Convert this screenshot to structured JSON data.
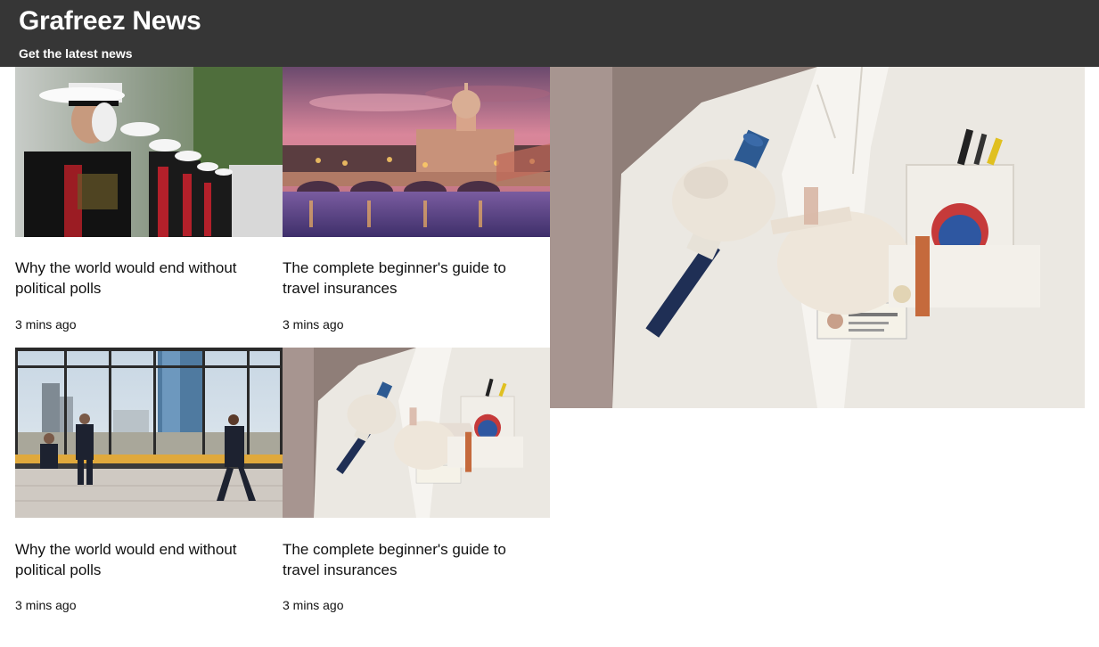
{
  "header": {
    "title": "Grafreez News",
    "tagline": "Get the latest news"
  },
  "articles": [
    {
      "title": "Why the world would end without political polls",
      "time": "3 mins ago",
      "image": "marines-saluting-photo"
    },
    {
      "title": "The complete beginner's guide to travel insurances",
      "time": "3 mins ago",
      "image": "rome-sunset-bridge-photo"
    },
    {
      "title": "Why the world would end without political polls",
      "time": "3 mins ago",
      "image": "office-window-skyline-photo"
    },
    {
      "title": "The complete beginner's guide to travel insurances",
      "time": "3 mins ago",
      "image": "lab-pipette-photo"
    }
  ],
  "featured": {
    "image": "lab-pipette-photo"
  }
}
